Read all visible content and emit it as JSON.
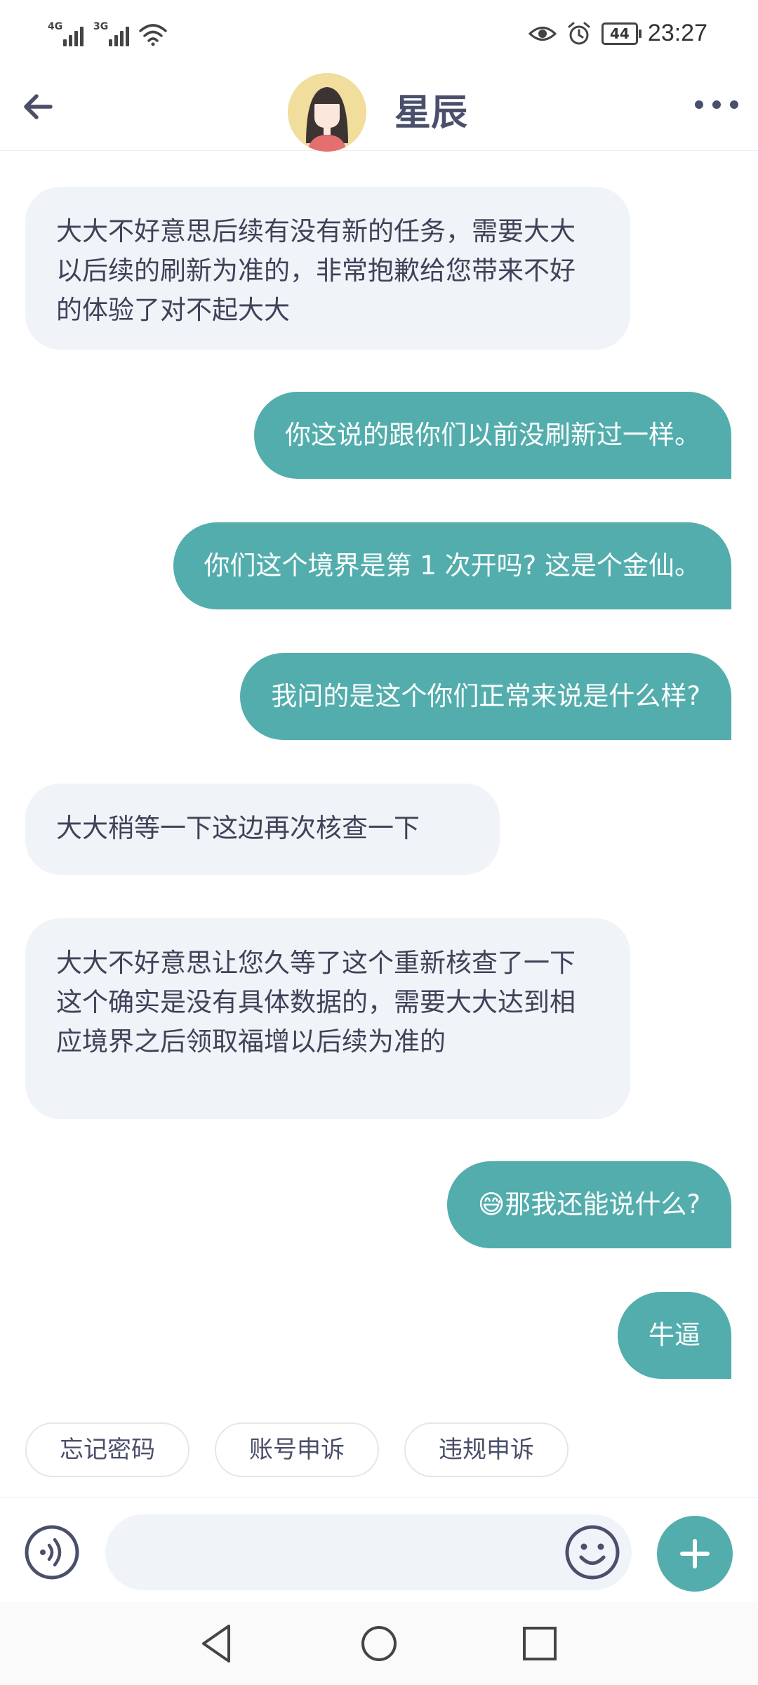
{
  "status_bar": {
    "signal1_label": "4G",
    "signal2_label": "3G",
    "battery": "44",
    "time": "23:27"
  },
  "header": {
    "title": "星辰",
    "back_icon": "arrow-left-icon",
    "more_icon": "more-horizontal-icon"
  },
  "messages": [
    {
      "side": "in",
      "text": "大大不好意思后续有没有新的任务，需要大大以后续的刷新为准的，非常抱歉给您带来不好的体验了对不起大大"
    },
    {
      "side": "out",
      "text": "你这说的跟你们以前没刷新过一样。"
    },
    {
      "side": "out",
      "text": "你们这个境界是第 1 次开吗? 这是个金仙。"
    },
    {
      "side": "out",
      "text": "我问的是这个你们正常来说是什么样?"
    },
    {
      "side": "in",
      "text": "大大稍等一下这边再次核查一下"
    },
    {
      "side": "in",
      "text": "大大不好意思让您久等了这个重新核查了一下这个确实是没有具体数据的，需要大大达到相应境界之后领取福增以后续为准的"
    },
    {
      "side": "out",
      "text": "😅那我还能说什么?"
    },
    {
      "side": "out",
      "text": "牛逼"
    }
  ],
  "quick_replies": [
    "忘记密码",
    "账号申诉",
    "违规申诉"
  ],
  "input": {
    "placeholder": "",
    "value": ""
  },
  "colors": {
    "accent": "#53adad",
    "incoming_bg": "#f0f3f7",
    "text": "#3f4258"
  }
}
